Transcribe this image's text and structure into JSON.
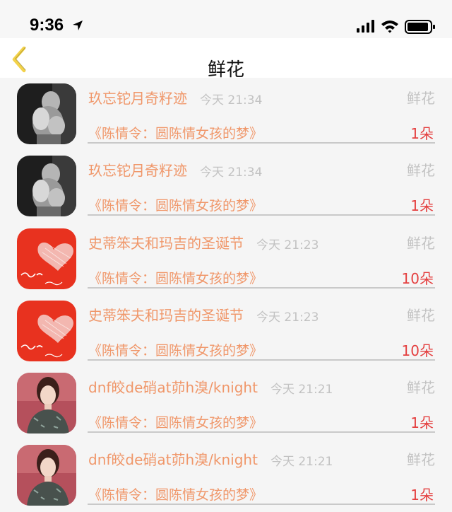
{
  "status_bar": {
    "time": "9:36",
    "icons": [
      "location-arrow-icon",
      "cellular-signal-icon",
      "wifi-icon",
      "battery-icon"
    ]
  },
  "nav": {
    "title": "鲜花",
    "back_icon": "chevron-left-icon",
    "back_color": "#f3d24a"
  },
  "colors": {
    "name": "#f0976a",
    "muted": "#c2c2c2",
    "qty": "#e44040"
  },
  "items": [
    {
      "sender": "玖忘铊月奇籽迹",
      "time": "今天 21:34",
      "type": "鲜花",
      "book": "《陈情令：圆陈情女孩的梦》",
      "qty": "1朵",
      "avatar": "bw-photo"
    },
    {
      "sender": "玖忘铊月奇籽迹",
      "time": "今天 21:34",
      "type": "鲜花",
      "book": "《陈情令：圆陈情女孩的梦》",
      "qty": "1朵",
      "avatar": "bw-photo"
    },
    {
      "sender": "史蒂笨夫和玛吉的圣诞节",
      "time": "今天 21:23",
      "type": "鲜花",
      "book": "《陈情令：圆陈情女孩的梦》",
      "qty": "10朵",
      "avatar": "red-heart"
    },
    {
      "sender": "史蒂笨夫和玛吉的圣诞节",
      "time": "今天 21:23",
      "type": "鲜花",
      "book": "《陈情令：圆陈情女孩的梦》",
      "qty": "10朵",
      "avatar": "red-heart"
    },
    {
      "sender": "dnf皎de硝at茆h溴/knight",
      "time": "今天 21:21",
      "type": "鲜花",
      "book": "《陈情令：圆陈情女孩的梦》",
      "qty": "1朵",
      "avatar": "woman-portrait"
    },
    {
      "sender": "dnf皎de硝at茆h溴/knight",
      "time": "今天 21:21",
      "type": "鲜花",
      "book": "《陈情令：圆陈情女孩的梦》",
      "qty": "1朵",
      "avatar": "woman-portrait"
    }
  ]
}
